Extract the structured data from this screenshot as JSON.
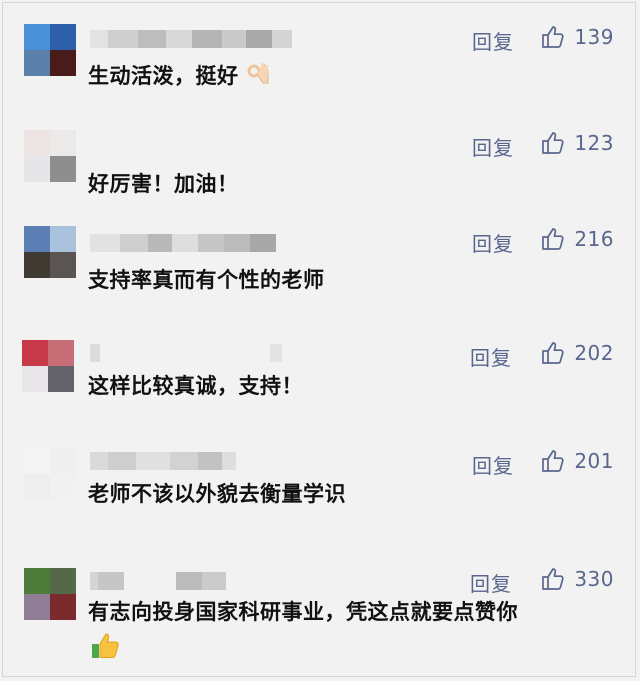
{
  "ui": {
    "accent": "#59668d",
    "reply_label": "回复",
    "thumb_icon": "thumbs-up-outline-icon"
  },
  "comments": [
    {
      "text": "生动活泼，挺好",
      "likes": "139",
      "emoji": "ok-hand-emoji",
      "avatar_colors": [
        "#4a90d9",
        "#2d5faa",
        "#5a7fa8",
        "#4a1b1b"
      ]
    },
    {
      "text": "好厉害！加油！",
      "likes": "123",
      "avatar_colors": [
        "#ece5e3",
        "#eceae9",
        "#e6e6e8",
        "#8e8e8e"
      ]
    },
    {
      "text": "支持率真而有个性的老师",
      "likes": "216",
      "avatar_colors": [
        "#5b7fb5",
        "#a9c1db",
        "#3f3b32",
        "#5a5452"
      ]
    },
    {
      "text": "这样比较真诚，支持！",
      "likes": "202",
      "avatar_colors": [
        "#c83a4a",
        "#c66d75",
        "#e8e6e8",
        "#63626a"
      ]
    },
    {
      "text": "老师不该以外貌去衡量学识",
      "likes": "201",
      "avatar_colors": [
        "#f4f4f4",
        "#efefef",
        "#eeeeee",
        "#f1f1f1"
      ]
    },
    {
      "text": "有志向投身国家科研事业，凭这点就要点赞你",
      "likes": "330",
      "emoji": "thumbs-up-emoji",
      "avatar_colors": [
        "#4e7a3a",
        "#56684a",
        "#8f7c95",
        "#7b2a2e"
      ]
    }
  ]
}
